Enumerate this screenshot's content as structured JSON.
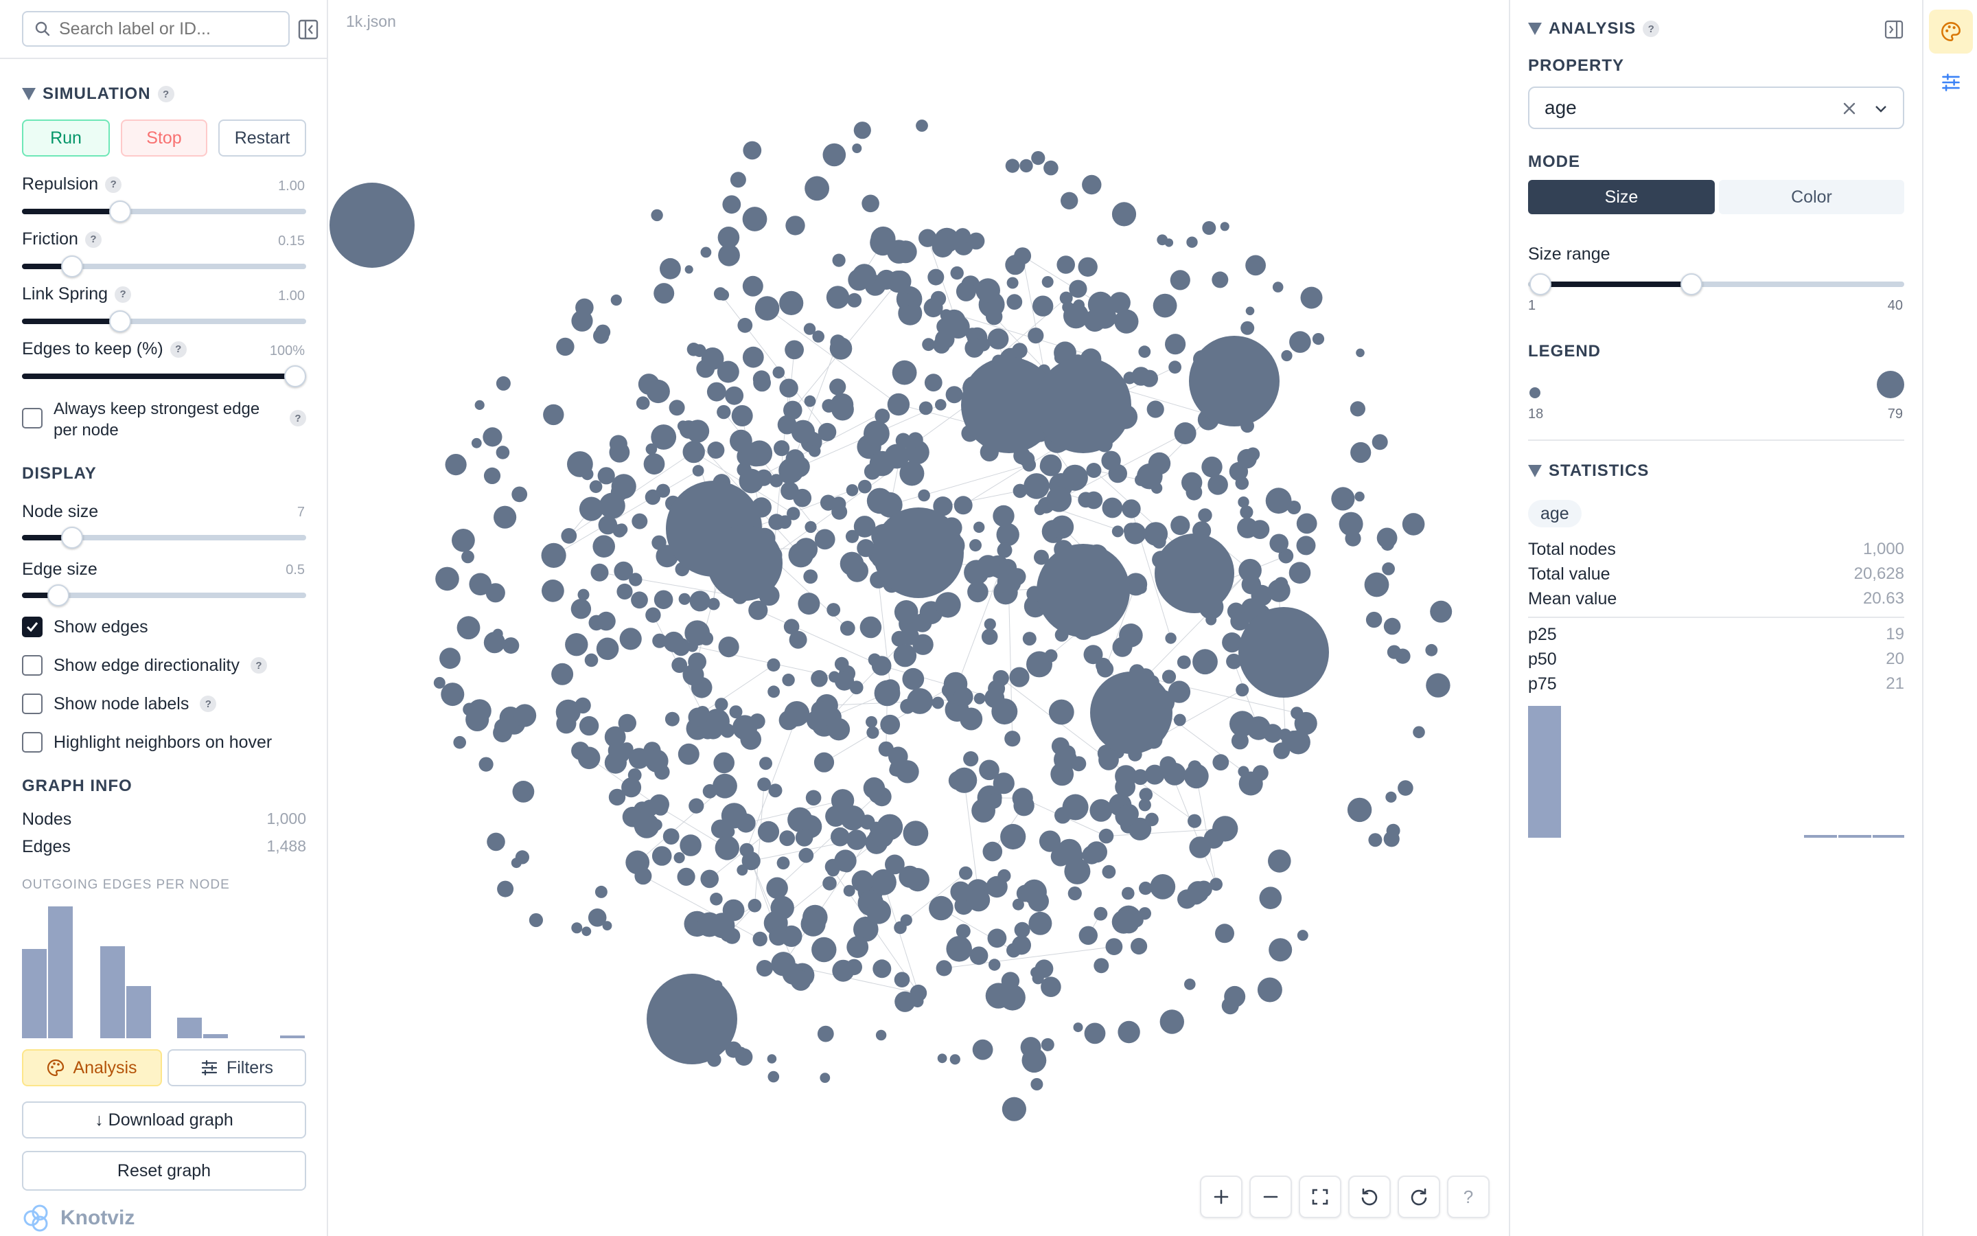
{
  "search": {
    "placeholder": "Search label or ID..."
  },
  "simulation": {
    "title": "SIMULATION",
    "run_label": "Run",
    "stop_label": "Stop",
    "restart_label": "Restart",
    "repulsion": {
      "label": "Repulsion",
      "value": "1.00"
    },
    "friction": {
      "label": "Friction",
      "value": "0.15"
    },
    "link_spring": {
      "label": "Link Spring",
      "value": "1.00"
    },
    "edges_keep": {
      "label": "Edges to keep (%)",
      "value": "100%"
    },
    "keep_strongest_line1": "Always keep strongest edge",
    "keep_strongest_line2": "per node"
  },
  "display": {
    "title": "DISPLAY",
    "node_size": {
      "label": "Node size",
      "value": "7"
    },
    "edge_size": {
      "label": "Edge size",
      "value": "0.5"
    },
    "show_edges": "Show edges",
    "show_edge_dir": "Show edge directionality",
    "show_node_labels": "Show node labels",
    "highlight": "Highlight neighbors on hover"
  },
  "graph_info": {
    "title": "GRAPH INFO",
    "nodes_label": "Nodes",
    "nodes_value": "1,000",
    "edges_label": "Edges",
    "edges_value": "1,488",
    "outgoing_title": "OUTGOING EDGES PER NODE"
  },
  "footer": {
    "analysis_label": "Analysis",
    "filters_label": "Filters",
    "download_label": "↓ Download graph",
    "reset_label": "Reset graph",
    "logo_text": "Knotviz"
  },
  "canvas": {
    "file_name": "1k.json",
    "help": "?"
  },
  "analysis": {
    "title": "ANALYSIS",
    "property_label": "PROPERTY",
    "property_value": "age",
    "mode_label": "MODE",
    "mode_size": "Size",
    "mode_color": "Color",
    "size_range_label": "Size range",
    "size_min": "1",
    "size_max": "40",
    "legend_label": "LEGEND",
    "legend_min": "18",
    "legend_max": "79"
  },
  "statistics": {
    "title": "STATISTICS",
    "chip": "age",
    "total_nodes_label": "Total nodes",
    "total_nodes": "1,000",
    "total_value_label": "Total value",
    "total_value": "20,628",
    "mean_value_label": "Mean value",
    "mean_value": "20.63",
    "p25_label": "p25",
    "p25": "19",
    "p50_label": "p50",
    "p50": "20",
    "p75_label": "p75",
    "p75": "21"
  },
  "colors": {
    "node": "#64748b",
    "accent_run": "#059669",
    "accent_analysis": "#b45309",
    "mode_active": "#334155"
  }
}
